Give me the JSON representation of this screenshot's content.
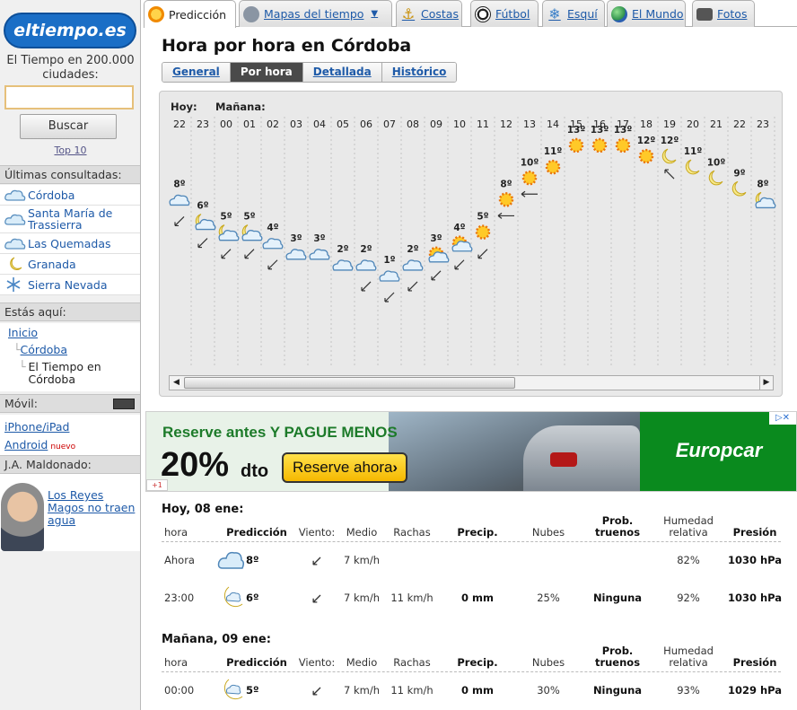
{
  "brand": {
    "logo_text": "eltiempo.es",
    "tagline": "El Tiempo en 200.000 ciudades:"
  },
  "search": {
    "placeholder": "",
    "button_label": "Buscar",
    "top10": "Top 10"
  },
  "recent": {
    "title": "Últimas consultadas:",
    "items": [
      {
        "label": "Córdoba",
        "icon": "cloud-icon"
      },
      {
        "label": "Santa María de Trassierra",
        "icon": "cloud-icon"
      },
      {
        "label": "Las Quemadas",
        "icon": "cloud-icon"
      },
      {
        "label": "Granada",
        "icon": "moon-icon"
      },
      {
        "label": "Sierra Nevada",
        "icon": "snowflake-icon"
      }
    ]
  },
  "breadcrumb": {
    "title": "Estás aquí:",
    "items": [
      "Inicio",
      "Córdoba",
      "El Tiempo en Córdoba"
    ]
  },
  "mobile": {
    "title": "Móvil:",
    "links": [
      "iPhone/iPad",
      "Android"
    ],
    "new_badge": "nuevo"
  },
  "author": {
    "title": "J.A. Maldonado:",
    "link": "Los Reyes Magos no traen agua"
  },
  "tabs": [
    {
      "label": "Predicción",
      "icon": "sun-icon",
      "active": true
    },
    {
      "label": "Mapas del tiempo",
      "icon": "satellite-icon",
      "active": false,
      "has_dropdown": true
    },
    {
      "label": "Costas",
      "icon": "anchor-icon",
      "active": false
    },
    {
      "label": "Fútbol",
      "icon": "football-icon",
      "active": false
    },
    {
      "label": "Esquí",
      "icon": "snowflake-icon",
      "active": false
    },
    {
      "label": "El Mundo",
      "icon": "globe-icon",
      "active": false
    },
    {
      "label": "Fotos",
      "icon": "camera-icon",
      "active": false
    }
  ],
  "page": {
    "title": "Hora por hora en Córdoba"
  },
  "subtabs": [
    {
      "label": "General",
      "active": false
    },
    {
      "label": "Por hora",
      "active": true
    },
    {
      "label": "Detallada",
      "active": false
    },
    {
      "label": "Histórico",
      "active": false
    }
  ],
  "chart_data": {
    "type": "line",
    "day_labels": [
      "Hoy:",
      "Mañana:"
    ],
    "categories": [
      "22",
      "23",
      "00",
      "01",
      "02",
      "03",
      "04",
      "05",
      "06",
      "07",
      "08",
      "09",
      "10",
      "11",
      "12",
      "13",
      "14",
      "15",
      "16",
      "17",
      "18",
      "19",
      "20",
      "21",
      "22",
      "23"
    ],
    "series": [
      {
        "values": [
          8,
          6,
          5,
          5,
          4,
          3,
          3,
          2,
          2,
          1,
          2,
          3,
          4,
          5,
          8,
          10,
          11,
          13,
          13,
          13,
          12,
          12,
          11,
          10,
          9,
          8
        ]
      }
    ],
    "temperature_labels": [
      "8º",
      "6º",
      "5º",
      "5º",
      "4º",
      "3º",
      "3º",
      "2º",
      "2º",
      "1º",
      "2º",
      "3º",
      "4º",
      "5º",
      "8º",
      "10º",
      "11º",
      "13º",
      "13º",
      "13º",
      "12º",
      "12º",
      "11º",
      "10º",
      "9º",
      "8º"
    ],
    "icons": [
      "cloud",
      "moon-cloud",
      "moon-cloud",
      "moon-cloud",
      "cloud",
      "cloud",
      "cloud",
      "cloud",
      "cloud",
      "cloud",
      "cloud",
      "sun-cloud",
      "sun-cloud",
      "sun",
      "sun",
      "sun",
      "sun",
      "sun",
      "sun",
      "sun",
      "sun",
      "moon",
      "moon",
      "moon",
      "moon",
      "moon-cloud"
    ],
    "wind_dirs": [
      "sw",
      "sw",
      "sw",
      "sw",
      "sw",
      "none",
      "none",
      "none",
      "sw",
      "sw",
      "sw",
      "sw",
      "sw",
      "sw",
      "w",
      "w",
      "none",
      "none",
      "none",
      "none",
      "none",
      "nw",
      "none",
      "none",
      "none",
      "none"
    ],
    "xlabel": "",
    "ylabel": ""
  },
  "ad": {
    "headline": "Reserve antes Y PAGUE MENOS",
    "percent": "20%",
    "dto": "dto",
    "cta": "Reserve ahora",
    "brand": "Europcar",
    "close": "▷✕",
    "plus": "+1"
  },
  "today": {
    "title": "Hoy, 08 ene:",
    "headers": {
      "hora": "hora",
      "prediccion": "Predicción",
      "viento": "Viento:",
      "medio": "Medio",
      "rachas": "Rachas",
      "precip": "Precip.",
      "nubes": "Nubes",
      "truenos": "Prob. truenos",
      "humedad": "Humedad relativa",
      "presion": "Presión"
    },
    "rows": [
      {
        "hora": "Ahora",
        "icon": "cloud",
        "temp": "8º",
        "medio": "7 km/h",
        "rachas": "",
        "precip": "",
        "nubes": "",
        "truenos": "",
        "humedad": "82%",
        "presion": "1030 hPa"
      },
      {
        "hora": "23:00",
        "icon": "moon-cloud",
        "temp": "6º",
        "medio": "7 km/h",
        "rachas": "11 km/h",
        "precip": "0 mm",
        "nubes": "25%",
        "truenos": "Ninguna",
        "humedad": "92%",
        "presion": "1030 hPa"
      }
    ]
  },
  "tomorrow": {
    "title": "Mañana, 09 ene:",
    "headers": {
      "hora": "hora",
      "prediccion": "Predicción",
      "viento": "Viento:",
      "medio": "Medio",
      "rachas": "Rachas",
      "precip": "Precip.",
      "nubes": "Nubes",
      "truenos": "Prob. truenos",
      "humedad": "Humedad relativa",
      "presion": "Presión"
    },
    "rows": [
      {
        "hora": "00:00",
        "icon": "moon-cloud",
        "temp": "5º",
        "medio": "7 km/h",
        "rachas": "11 km/h",
        "precip": "0 mm",
        "nubes": "30%",
        "truenos": "Ninguna",
        "humedad": "93%",
        "presion": "1029 hPa"
      }
    ]
  },
  "colors": {
    "link": "#1e5aa8",
    "sun": "#f5a623",
    "moon": "#f3e07a",
    "cloud": "#7fb3d9",
    "ad_green": "#0a8a1e"
  }
}
